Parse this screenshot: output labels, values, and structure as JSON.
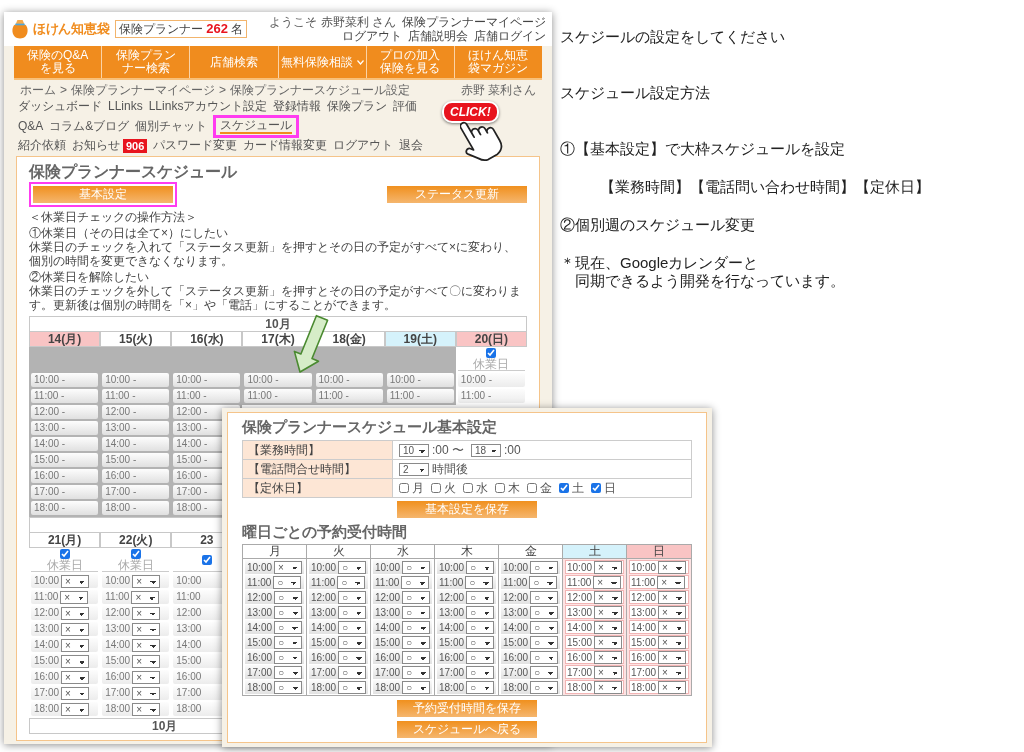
{
  "back_page": {
    "header": {
      "logo_text": "ほけん知恵袋",
      "counter": {
        "label": "保険プランナー",
        "count": "262",
        "unit": "名"
      },
      "welcome": "ようこそ 赤野菜利 さん",
      "links": [
        "保険プランナーマイページ",
        "ログアウト",
        "店舗説明会",
        "店舗ログイン"
      ]
    },
    "nav": [
      {
        "label": "保険のQ&Aを見る",
        "dropdown": false
      },
      {
        "label": "保険プランナー検索",
        "dropdown": false
      },
      {
        "label": "店舗検索",
        "dropdown": false
      },
      {
        "label": "無料保険相談",
        "dropdown": true
      },
      {
        "label": "プロの加入保険を見る",
        "dropdown": false
      },
      {
        "label": "ほけん知恵袋マガジン",
        "dropdown": false
      }
    ],
    "breadcrumb": {
      "items": [
        "ホーム",
        "保険プランナーマイページ",
        "保険プランナースケジュール設定"
      ],
      "separator": ">"
    },
    "user_name": "赤野 菜利さん",
    "menu": {
      "rows": [
        [
          {
            "label": "ダッシュボード",
            "selected": false,
            "highlighted": false
          },
          {
            "label": "LLinks",
            "selected": false,
            "highlighted": false
          },
          {
            "label": "LLinksアカウント設定",
            "selected": false,
            "highlighted": false
          },
          {
            "label": "登録情報",
            "selected": false,
            "highlighted": false
          },
          {
            "label": "保険プラン",
            "selected": false,
            "highlighted": false
          },
          {
            "label": "評価",
            "selected": false,
            "highlighted": false
          },
          {
            "label": "Q&A",
            "selected": false,
            "highlighted": false
          },
          {
            "label": "コラム&ブログ",
            "selected": false,
            "highlighted": false
          },
          {
            "label": "個別チャット",
            "selected": false,
            "highlighted": false
          },
          {
            "label": "スケジュール",
            "selected": true,
            "highlighted": true
          }
        ],
        [
          {
            "label": "紹介依頼",
            "selected": false,
            "highlighted": false
          },
          {
            "label": "お知らせ",
            "selected": false,
            "highlighted": false,
            "badge": "906"
          },
          {
            "label": "パスワード変更",
            "selected": false,
            "highlighted": false
          },
          {
            "label": "カード情報変更",
            "selected": false,
            "highlighted": false
          },
          {
            "label": "ログアウト",
            "selected": false,
            "highlighted": false
          },
          {
            "label": "退会",
            "selected": false,
            "highlighted": false
          }
        ]
      ]
    },
    "panel": {
      "title": "保険プランナースケジュール",
      "buttons": [
        {
          "label": "基本設定",
          "highlighted": true
        },
        {
          "label": "ステータス更新",
          "highlighted": false
        }
      ],
      "help": {
        "heading": "＜休業日チェックの操作方法＞",
        "items": [
          {
            "title": "①休業日（その日は全て×）にしたい",
            "text": "休業日のチェックを入れて「ステータス更新」を押すとその日の予定がすべて×に変わり、個別の時間を変更できなくなります。"
          },
          {
            "title": "②休業日を解除したい",
            "text": "休業日のチェックを外して「ステータス更新」を押すとその日の予定がすべて〇に変わります。更新後は個別の時間を「×」や「電話」にすることができます。"
          }
        ]
      },
      "weeks": [
        {
          "month": "10月",
          "days": [
            {
              "label": "14(月)",
              "kind": "holiday",
              "disabled": true,
              "slots": [
                {
                  "time": "10:00 -"
                },
                {
                  "time": "11:00 -"
                },
                {
                  "time": "12:00 -"
                },
                {
                  "time": "13:00 -"
                },
                {
                  "time": "14:00 -"
                },
                {
                  "time": "15:00 -"
                },
                {
                  "time": "16:00 -"
                },
                {
                  "time": "17:00 -"
                },
                {
                  "time": "18:00 -"
                }
              ]
            },
            {
              "label": "15(火)",
              "kind": "weekday",
              "disabled": true,
              "slots": [
                {
                  "time": "10:00 -"
                },
                {
                  "time": "11:00 -"
                },
                {
                  "time": "12:00 -"
                },
                {
                  "time": "13:00 -"
                },
                {
                  "time": "14:00 -"
                },
                {
                  "time": "15:00 -"
                },
                {
                  "time": "16:00 -"
                },
                {
                  "time": "17:00 -"
                },
                {
                  "time": "18:00 -"
                }
              ]
            },
            {
              "label": "16(水)",
              "kind": "weekday",
              "disabled": true,
              "slots": [
                {
                  "time": "10:00 -"
                },
                {
                  "time": "11:00 -"
                },
                {
                  "time": "12:00 -"
                },
                {
                  "time": "13:00 -"
                },
                {
                  "time": "14:00 -"
                },
                {
                  "time": "15:00 -"
                },
                {
                  "time": "16:00 -"
                },
                {
                  "time": "17:00 -"
                },
                {
                  "time": "18:00 -"
                }
              ]
            },
            {
              "label": "17(木)",
              "kind": "weekday",
              "disabled": true,
              "slots": [
                {
                  "time": "10:00 -"
                },
                {
                  "time": "11:00 -"
                }
              ]
            },
            {
              "label": "18(金)",
              "kind": "weekday",
              "disabled": true,
              "slots": [
                {
                  "time": "10:00 -"
                },
                {
                  "time": "11:00 -"
                }
              ]
            },
            {
              "label": "19(土)",
              "kind": "saturday",
              "disabled": true,
              "slots": [
                {
                  "time": "10:00 -"
                },
                {
                  "time": "11:00 -"
                }
              ]
            },
            {
              "label": "20(日)",
              "kind": "sunday",
              "disabled": false,
              "check": {
                "checked": true,
                "label": "休業日"
              },
              "slots": [
                {
                  "time": "10:00 -"
                },
                {
                  "time": "11:00 -"
                }
              ]
            }
          ]
        },
        {
          "days": [
            {
              "label": "21(月)",
              "kind": "weekday",
              "disabled": false,
              "check": {
                "checked": true,
                "label": "休業日"
              },
              "slots": [
                {
                  "time": "10:00",
                  "value": "×"
                },
                {
                  "time": "11:00",
                  "value": "×"
                },
                {
                  "time": "12:00",
                  "value": "×"
                },
                {
                  "time": "13:00",
                  "value": "×"
                },
                {
                  "time": "14:00",
                  "value": "×"
                },
                {
                  "time": "15:00",
                  "value": "×"
                },
                {
                  "time": "16:00",
                  "value": "×"
                },
                {
                  "time": "17:00",
                  "value": "×"
                },
                {
                  "time": "18:00",
                  "value": "×"
                }
              ]
            },
            {
              "label": "22(火)",
              "kind": "weekday",
              "disabled": false,
              "check": {
                "checked": true,
                "label": "休業日"
              },
              "slots": [
                {
                  "time": "10:00",
                  "value": "×"
                },
                {
                  "time": "11:00",
                  "value": "×"
                },
                {
                  "time": "12:00",
                  "value": "×"
                },
                {
                  "time": "13:00",
                  "value": "×"
                },
                {
                  "time": "14:00",
                  "value": "×"
                },
                {
                  "time": "15:00",
                  "value": "×"
                },
                {
                  "time": "16:00",
                  "value": "×"
                },
                {
                  "time": "17:00",
                  "value": "×"
                },
                {
                  "time": "18:00",
                  "value": "×"
                }
              ]
            },
            {
              "label": "23",
              "kind": "weekday",
              "disabled": false,
              "check": {
                "checked": true
              },
              "slots": [
                {
                  "time": "10:00"
                },
                {
                  "time": "11:00"
                },
                {
                  "time": "12:00"
                },
                {
                  "time": "13:00"
                },
                {
                  "time": "14:00"
                },
                {
                  "time": "15:00"
                },
                {
                  "time": "16:00"
                },
                {
                  "time": "17:00"
                },
                {
                  "time": "18:00"
                }
              ]
            }
          ]
        },
        {
          "month": "10月"
        }
      ]
    }
  },
  "click_callout": "CLICK!",
  "detail_window": {
    "title": "保険プランナースケジュール基本設定",
    "settings": [
      {
        "label": "【業務時間】",
        "controls": [
          {
            "kind": "select",
            "value": "10"
          },
          {
            "kind": "text",
            "text": ":00 〜"
          },
          {
            "kind": "select",
            "value": "18"
          },
          {
            "kind": "text",
            "text": ":00"
          }
        ]
      },
      {
        "label": "【電話問合せ時間】",
        "controls": [
          {
            "kind": "select",
            "value": "2"
          },
          {
            "kind": "text",
            "text": "時間後"
          }
        ]
      },
      {
        "label": "【定休日】",
        "controls": [
          {
            "kind": "checkbox",
            "label": "月",
            "checked": false
          },
          {
            "kind": "checkbox",
            "label": "火",
            "checked": false
          },
          {
            "kind": "checkbox",
            "label": "水",
            "checked": false
          },
          {
            "kind": "checkbox",
            "label": "木",
            "checked": false
          },
          {
            "kind": "checkbox",
            "label": "金",
            "checked": false
          },
          {
            "kind": "checkbox",
            "label": "土",
            "checked": true
          },
          {
            "kind": "checkbox",
            "label": "日",
            "checked": true
          }
        ]
      }
    ],
    "save_button": "基本設定を保存",
    "weekly_heading": "曜日ごとの予約受付時間",
    "weekly": [
      {
        "label": "月",
        "kind": "weekday",
        "slots": [
          {
            "time": "10:00",
            "value": "×"
          },
          {
            "time": "11:00",
            "value": "○"
          },
          {
            "time": "12:00",
            "value": "○"
          },
          {
            "time": "13:00",
            "value": "○"
          },
          {
            "time": "14:00",
            "value": "○"
          },
          {
            "time": "15:00",
            "value": "○"
          },
          {
            "time": "16:00",
            "value": "○"
          },
          {
            "time": "17:00",
            "value": "○"
          },
          {
            "time": "18:00",
            "value": "○"
          }
        ]
      },
      {
        "label": "火",
        "kind": "weekday",
        "slots": [
          {
            "time": "10:00",
            "value": "○"
          },
          {
            "time": "11:00",
            "value": "○"
          },
          {
            "time": "12:00",
            "value": "○"
          },
          {
            "time": "13:00",
            "value": "○"
          },
          {
            "time": "14:00",
            "value": "○"
          },
          {
            "time": "15:00",
            "value": "○"
          },
          {
            "time": "16:00",
            "value": "○"
          },
          {
            "time": "17:00",
            "value": "○"
          },
          {
            "time": "18:00",
            "value": "○"
          }
        ]
      },
      {
        "label": "水",
        "kind": "weekday",
        "slots": [
          {
            "time": "10:00",
            "value": "○"
          },
          {
            "time": "11:00",
            "value": "○"
          },
          {
            "time": "12:00",
            "value": "○"
          },
          {
            "time": "13:00",
            "value": "○"
          },
          {
            "time": "14:00",
            "value": "○"
          },
          {
            "time": "15:00",
            "value": "○"
          },
          {
            "time": "16:00",
            "value": "○"
          },
          {
            "time": "17:00",
            "value": "○"
          },
          {
            "time": "18:00",
            "value": "○"
          }
        ]
      },
      {
        "label": "木",
        "kind": "weekday",
        "slots": [
          {
            "time": "10:00",
            "value": "○"
          },
          {
            "time": "11:00",
            "value": "○"
          },
          {
            "time": "12:00",
            "value": "○"
          },
          {
            "time": "13:00",
            "value": "○"
          },
          {
            "time": "14:00",
            "value": "○"
          },
          {
            "time": "15:00",
            "value": "○"
          },
          {
            "time": "16:00",
            "value": "○"
          },
          {
            "time": "17:00",
            "value": "○"
          },
          {
            "time": "18:00",
            "value": "○"
          }
        ]
      },
      {
        "label": "金",
        "kind": "weekday",
        "slots": [
          {
            "time": "10:00",
            "value": "○"
          },
          {
            "time": "11:00",
            "value": "○"
          },
          {
            "time": "12:00",
            "value": "○"
          },
          {
            "time": "13:00",
            "value": "○"
          },
          {
            "time": "14:00",
            "value": "○"
          },
          {
            "time": "15:00",
            "value": "○"
          },
          {
            "time": "16:00",
            "value": "○"
          },
          {
            "time": "17:00",
            "value": "○"
          },
          {
            "time": "18:00",
            "value": "○"
          }
        ]
      },
      {
        "label": "土",
        "kind": "saturday",
        "slots": [
          {
            "time": "10:00",
            "value": "×"
          },
          {
            "time": "11:00",
            "value": "×"
          },
          {
            "time": "12:00",
            "value": "×"
          },
          {
            "time": "13:00",
            "value": "×"
          },
          {
            "time": "14:00",
            "value": "×"
          },
          {
            "time": "15:00",
            "value": "×"
          },
          {
            "time": "16:00",
            "value": "×"
          },
          {
            "time": "17:00",
            "value": "×"
          },
          {
            "time": "18:00",
            "value": "×"
          }
        ]
      },
      {
        "label": "日",
        "kind": "sunday",
        "slots": [
          {
            "time": "10:00",
            "value": "×"
          },
          {
            "time": "11:00",
            "value": "×"
          },
          {
            "time": "12:00",
            "value": "×"
          },
          {
            "time": "13:00",
            "value": "×"
          },
          {
            "time": "14:00",
            "value": "×"
          },
          {
            "time": "15:00",
            "value": "×"
          },
          {
            "time": "16:00",
            "value": "×"
          },
          {
            "time": "17:00",
            "value": "×"
          },
          {
            "time": "18:00",
            "value": "×"
          }
        ]
      }
    ],
    "buttons": [
      "予約受付時間を保存",
      "スケジュールへ戻る"
    ]
  },
  "notes": [
    {
      "kind": "title",
      "text": "スケジールの設定をしてください"
    },
    {
      "kind": "title",
      "text": "スケジュール設定方法"
    },
    {
      "kind": "step",
      "text": "①【基本設定】で大枠スケジュールを設定"
    },
    {
      "kind": "detail",
      "text": "【業務時間】【電話問い合わせ時間】【定休日】"
    },
    {
      "kind": "step",
      "text": "②個別週のスケジュール変更"
    },
    {
      "kind": "note",
      "text": "＊現在、Googleカレンダーと"
    },
    {
      "kind": "note_continued",
      "text": "同期できるよう開発を行なっています。"
    }
  ]
}
